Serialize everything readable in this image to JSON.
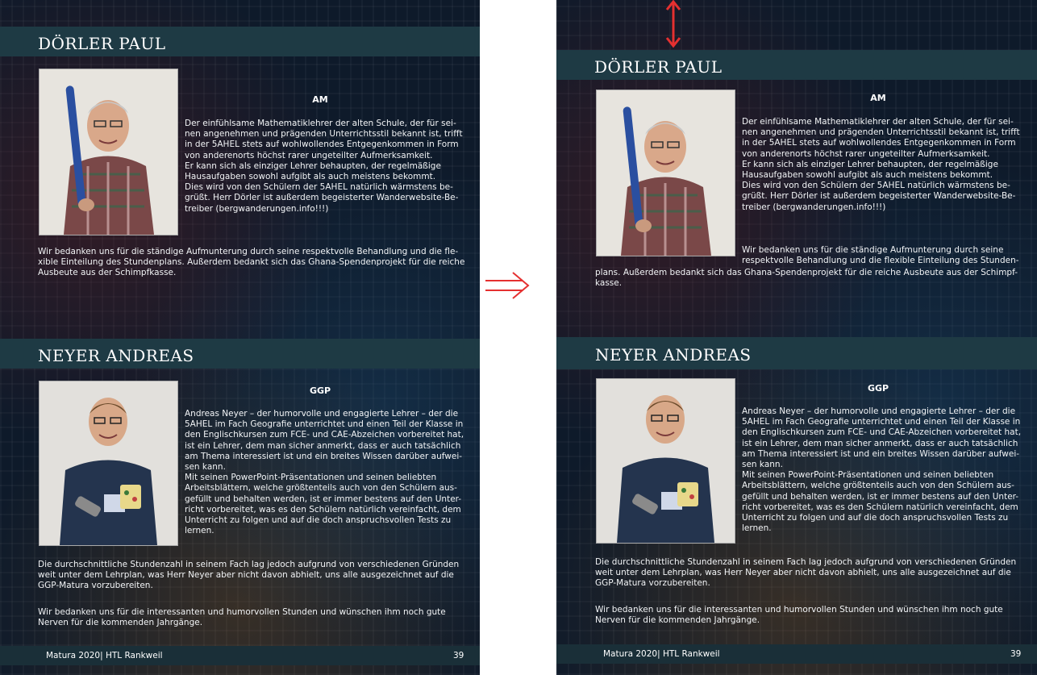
{
  "left_page": {
    "teacher1": {
      "name": "DÖRLER PAUL",
      "subject": "AM",
      "description": "Der einfühlsame Mathematiklehrer der alten Schule, der für sei-\nnen angenehmen und prägenden Unterrichtsstil bekannt ist, trifft\nin der 5AHEL stets auf wohlwollendes Entgegenkommen in Form\nvon anderenorts höchst rarer ungeteilter Aufmerksamkeit.\nEr kann sich als einziger Lehrer behaupten, der regelmäßige\nHausaufgaben sowohl aufgibt als auch meistens bekommt.\nDies wird von den Schülern der 5AHEL natürlich wärmstens be-\ngrüßt. Herr Dörler ist außerdem begeisterter Wanderwebsite-Be-\ntreiber (bergwanderungen.info!!!)",
      "thanks": "Wir bedanken uns für die ständige Aufmunterung durch seine respektvolle Behandlung und die fle-\nxible Einteilung des Stundenplans. Außerdem bedankt sich das Ghana-Spendenprojekt für die reiche\nAusbeute aus der Schimpfkasse."
    },
    "teacher2": {
      "name": "NEYER ANDREAS",
      "subject": "GGP",
      "description": "Andreas Neyer – der humorvolle und engagierte Lehrer – der die\n5AHEL im Fach Geografie unterrichtet und einen Teil der Klasse in\nden Englischkursen zum FCE- und CAE-Abzeichen vorbereitet hat,\nist ein Lehrer, dem man sicher anmerkt, dass er auch tatsächlich\nam Thema interessiert ist und ein breites Wissen darüber aufwei-\nsen kann.\nMit seinen PowerPoint-Präsentationen und seinen beliebten\nArbeitsblättern, welche größtenteils auch von den Schülern aus-\ngefüllt und behalten werden, ist er immer bestens auf den Unter-\nricht vorbereitet, was es den Schülern natürlich vereinfacht, dem\nUnterricht zu folgen und auf die doch anspruchsvollen Tests zu\nlernen.",
      "para2": "Die durchschnittliche Stundenzahl in seinem Fach lag jedoch aufgrund von verschiedenen Gründen\nweit unter dem Lehrplan, was Herr Neyer aber nicht davon abhielt, uns alle ausgezeichnet auf die\nGGP-Matura vorzubereiten.",
      "para3": "Wir bedanken uns für die interessanten und humorvollen Stunden und wünschen ihm noch gute\nNerven für die kommenden Jahrgänge."
    },
    "footer": {
      "text": "Matura 2020| HTL Rankweil",
      "page": "39"
    }
  },
  "right_page": {
    "teacher1": {
      "name": "DÖRLER PAUL",
      "subject": "AM",
      "description": "Der einfühlsame Mathematiklehrer der alten Schule, der für sei-\nnen angenehmen und prägenden Unterrichtsstil bekannt ist, trifft\nin der 5AHEL stets auf wohlwollendes Entgegenkommen in Form\nvon anderenorts höchst rarer ungeteilter Aufmerksamkeit.\nEr kann sich als einziger Lehrer behaupten, der regelmäßige\nHausaufgaben sowohl aufgibt als auch meistens bekommt.\nDies wird von den Schülern der 5AHEL natürlich wärmstens be-\ngrüßt. Herr Dörler ist außerdem begeisterter Wanderwebsite-Be-\ntreiber (bergwanderungen.info!!!)",
      "thanks_a": "Wir bedanken uns für die ständige Aufmunterung durch seine\nrespektvolle Behandlung und die flexible Einteilung des Stunden-",
      "thanks_b": "plans. Außerdem bedankt sich das Ghana-Spendenprojekt für die reiche Ausbeute aus der Schimpf-\nkasse."
    },
    "teacher2": {
      "name": "NEYER ANDREAS",
      "subject": "GGP",
      "description": "Andreas Neyer – der humorvolle und engagierte Lehrer – der die\n5AHEL im Fach Geografie unterrichtet und einen Teil der Klasse in\nden Englischkursen zum FCE- und CAE-Abzeichen vorbereitet hat,\nist ein Lehrer, dem man sicher anmerkt, dass er auch tatsächlich\nam Thema interessiert ist und ein breites Wissen darüber aufwei-\nsen kann.\nMit seinen PowerPoint-Präsentationen und seinen beliebten\nArbeitsblättern, welche größtenteils auch von den Schülern aus-\ngefüllt und behalten werden, ist er immer bestens auf den Unter-\nricht vorbereitet, was es den Schülern natürlich vereinfacht, dem\nUnterricht zu folgen und auf die doch anspruchsvollen Tests zu\nlernen.",
      "para2": "Die durchschnittliche Stundenzahl in seinem Fach lag jedoch aufgrund von verschiedenen Gründen\nweit unter dem Lehrplan, was Herr Neyer aber nicht davon abhielt, uns alle ausgezeichnet auf die\nGGP-Matura vorzubereiten.",
      "para3": "Wir bedanken uns für die interessanten und humorvollen Stunden und wünschen ihm noch gute\nNerven für die kommenden Jahrgänge."
    },
    "footer": {
      "text": "Matura 2020| HTL Rankweil",
      "page": "39"
    }
  },
  "annotations": {
    "arrow_color": "#e53030",
    "band_color": "#1e3a44"
  }
}
